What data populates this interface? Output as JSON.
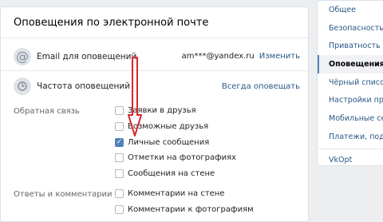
{
  "panel": {
    "title": "Оповещения по электронной почте",
    "email_row": {
      "label": "Email для оповещений",
      "value": "am***@yandex.ru",
      "action": "Изменить"
    },
    "frequency_row": {
      "label": "Частота оповещений",
      "value": "Всегда оповещать"
    },
    "sections": [
      {
        "label": "Обратная связь",
        "options": [
          {
            "label": "Заявки в друзья",
            "checked": false
          },
          {
            "label": "Возможные друзья",
            "checked": false
          },
          {
            "label": "Личные сообщения",
            "checked": true
          },
          {
            "label": "Отметки на фотографиях",
            "checked": false
          },
          {
            "label": "Сообщения на стене",
            "checked": false
          }
        ]
      },
      {
        "label": "Ответы и комментарии",
        "options": [
          {
            "label": "Комментарии на стене",
            "checked": false
          },
          {
            "label": "Комментарии к фотографиям",
            "checked": false
          }
        ]
      }
    ]
  },
  "sidebar": {
    "items": [
      {
        "label": "Общее",
        "active": false
      },
      {
        "label": "Безопасность",
        "active": false
      },
      {
        "label": "Приватность",
        "active": false
      },
      {
        "label": "Оповещения",
        "active": true
      },
      {
        "label": "Чёрный список",
        "active": false
      },
      {
        "label": "Настройки приложений",
        "active": false
      },
      {
        "label": "Мобильные сервисы",
        "active": false
      },
      {
        "label": "Платежи, подписки",
        "active": false
      },
      {
        "label": "VkOpt",
        "active": false
      }
    ]
  },
  "colors": {
    "accent": "#5181b8",
    "link": "#2a5885",
    "arrow": "#d7262b"
  }
}
